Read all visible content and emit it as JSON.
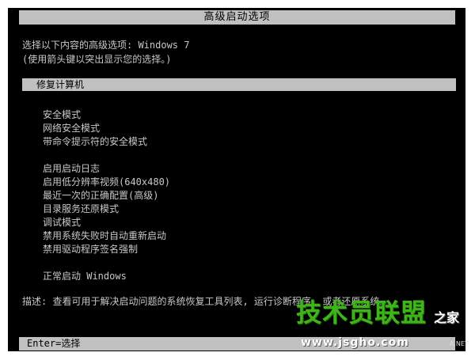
{
  "title": "高级启动选项",
  "prompt": "选择以下内容的高级选项: Windows 7",
  "hint": "(使用箭头键以突出显示您的选择。)",
  "selected_option": "修复计算机",
  "options_group1": [
    "安全模式",
    "网络安全模式",
    "带命令提示符的安全模式"
  ],
  "options_group2": [
    "启用启动日志",
    "启用低分辨率视频(640x480)",
    "最近一次的正确配置(高级)",
    "目录服务还原模式",
    "调试模式",
    "禁用系统失败时自动重新启动",
    "禁用驱动程序签名强制"
  ],
  "options_group3": [
    "正常启动 Windows"
  ],
  "description": "描述: 查看可用于解决启动问题的系统恢复工具列表, 运行诊断程序, 或者还原系统。",
  "footer": "Enter=选择",
  "watermark": {
    "main": "技术员联盟",
    "side": "之家",
    "url": "www.jsgho.com",
    "small": "A.NET"
  },
  "colors": {
    "background": "#000000",
    "text": "#c8c8c8",
    "bar": "#c0c0c0",
    "watermark_green": "#3fb51a"
  }
}
